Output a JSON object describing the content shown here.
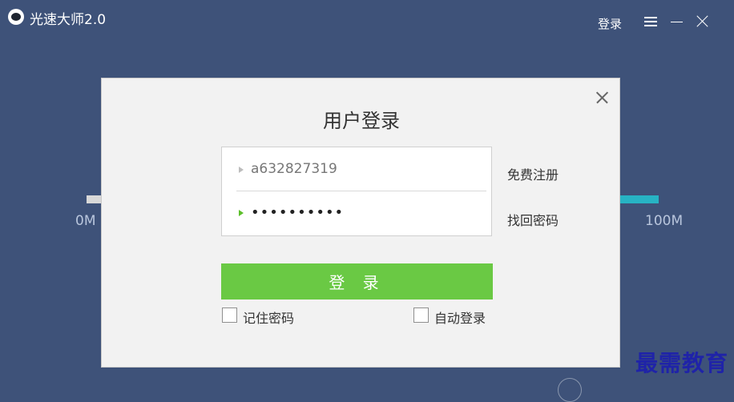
{
  "window": {
    "title": "光速大师2.0",
    "logo_icon": "app-logo-icon",
    "login_link": "登录",
    "controls": [
      "menu-icon",
      "minimize-icon",
      "close-icon"
    ]
  },
  "speed_scale": {
    "min_label": "0M",
    "max_label": "100M",
    "colors": {
      "background": "#3e5279",
      "left_bar": "#d8d8d8",
      "right_bar": "#27b3c4"
    }
  },
  "login_dialog": {
    "title": "用户登录",
    "username_value": "a632827319",
    "password_value": "••••••••••",
    "register_link": "免费注册",
    "recover_link": "找回密码",
    "submit_label": "登 录",
    "remember_label": "记住密码",
    "remember_checked": false,
    "auto_login_label": "自动登录",
    "auto_login_checked": false,
    "colors": {
      "submit": "#6ac944",
      "active_marker": "#5cbf2a"
    }
  },
  "watermark": {
    "text": "最需教育",
    "color": "#1f23a8"
  }
}
